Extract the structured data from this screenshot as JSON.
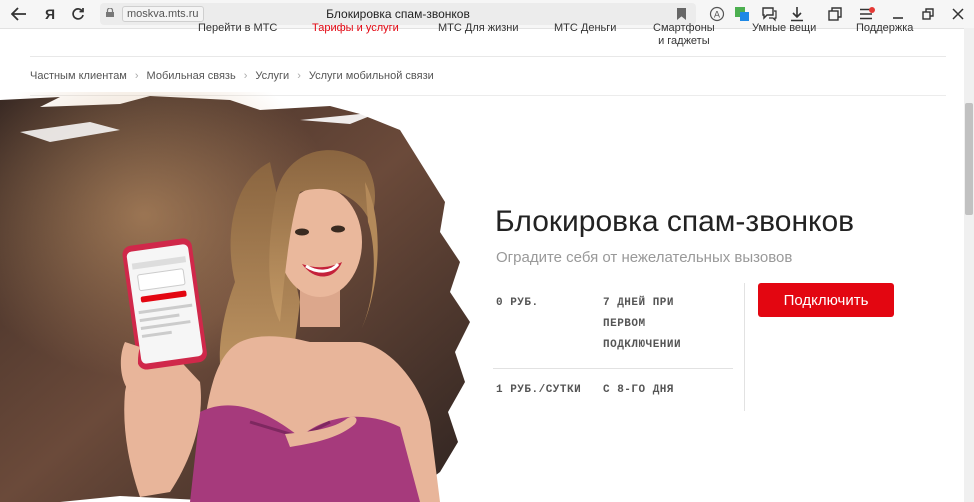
{
  "browser": {
    "back_icon": "back-arrow-icon",
    "yandex_logo": "Я",
    "reload_icon": "reload-icon",
    "address": {
      "url": "moskva.mts.ru",
      "page_title": "Блокировка спам-звонков"
    },
    "toolbar_icons": [
      "reader-icon",
      "translate-icon",
      "messages-icon",
      "download-icon",
      "collections-icon",
      "menu-icon",
      "minimize-icon",
      "restore-icon",
      "close-icon"
    ],
    "notification_color": "#e53935"
  },
  "site_nav": {
    "items": [
      "Перейти в МТС",
      "Тарифы и услуги",
      "МТС Для жизни",
      "МТС Деньги",
      "Смартфоны\nи гаджеты",
      "Умные вещи",
      "Поддержка"
    ],
    "active_color": "#e30611"
  },
  "breadcrumbs": [
    "Частным клиентам",
    "Мобильная связь",
    "Услуги",
    "Услуги мобильной связи"
  ],
  "service": {
    "title": "Блокировка спам-звонков",
    "subtitle": "Оградите себя от нежелательных вызовов",
    "rows": [
      {
        "price": "0 РУБ.",
        "condition": "7 ДНЕЙ ПРИ\nПЕРВОМ\nПОДКЛЮЧЕНИИ"
      },
      {
        "price": "1 РУБ./СУТКИ",
        "condition": "С 8-ГО ДНЯ"
      }
    ],
    "connect_button": "Подключить",
    "brand_color": "#e30611"
  }
}
